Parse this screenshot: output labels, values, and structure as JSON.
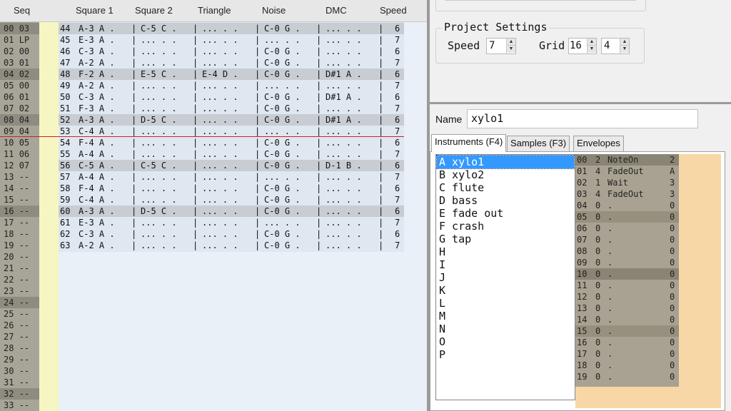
{
  "tracker": {
    "headers": [
      "Seq",
      "Square 1",
      "Square 2",
      "Triangle",
      "Noise",
      "DMC",
      "Speed"
    ],
    "seq": [
      [
        "00",
        "03"
      ],
      [
        "01",
        "LP"
      ],
      [
        "02",
        "00"
      ],
      [
        "03",
        "01"
      ],
      [
        "04",
        "02"
      ],
      [
        "05",
        "00"
      ],
      [
        "06",
        "01"
      ],
      [
        "07",
        "02"
      ],
      [
        "08",
        "04"
      ],
      [
        "09",
        "04"
      ],
      [
        "10",
        "05"
      ],
      [
        "11",
        "06"
      ],
      [
        "12",
        "07"
      ],
      [
        "13",
        "--"
      ],
      [
        "14",
        "--"
      ],
      [
        "15",
        "--"
      ],
      [
        "16",
        "--"
      ],
      [
        "17",
        "--"
      ],
      [
        "18",
        "--"
      ],
      [
        "19",
        "--"
      ],
      [
        "20",
        "--"
      ],
      [
        "21",
        "--"
      ],
      [
        "22",
        "--"
      ],
      [
        "23",
        "--"
      ],
      [
        "24",
        "--"
      ],
      [
        "25",
        "--"
      ],
      [
        "26",
        "--"
      ],
      [
        "27",
        "--"
      ],
      [
        "28",
        "--"
      ],
      [
        "29",
        "--"
      ],
      [
        "30",
        "--"
      ],
      [
        "31",
        "--"
      ],
      [
        "32",
        "--"
      ],
      [
        "33",
        "--"
      ]
    ],
    "seq_highlight": [
      0,
      4,
      8,
      16,
      24,
      32
    ],
    "pattern": [
      {
        "row": "44",
        "sq1": "A-3 A .",
        "sq2": "C-5 C .",
        "tri": "... . .",
        "noi": "C-0 G .",
        "dmc": "... . .",
        "spd": "6"
      },
      {
        "row": "45",
        "sq1": "E-3 A .",
        "sq2": "... . .",
        "tri": "... . .",
        "noi": "... . .",
        "dmc": "... . .",
        "spd": "7"
      },
      {
        "row": "46",
        "sq1": "C-3 A .",
        "sq2": "... . .",
        "tri": "... . .",
        "noi": "C-0 G .",
        "dmc": "... . .",
        "spd": "6"
      },
      {
        "row": "47",
        "sq1": "A-2 A .",
        "sq2": "... . .",
        "tri": "... . .",
        "noi": "C-0 G .",
        "dmc": "... . .",
        "spd": "7"
      },
      {
        "row": "48",
        "sq1": "F-2 A .",
        "sq2": "E-5 C .",
        "tri": "E-4 D .",
        "noi": "C-0 G .",
        "dmc": "D#1 A .",
        "spd": "6"
      },
      {
        "row": "49",
        "sq1": "A-2 A .",
        "sq2": "... . .",
        "tri": "... . .",
        "noi": "... . .",
        "dmc": "... . .",
        "spd": "7"
      },
      {
        "row": "50",
        "sq1": "C-3 A .",
        "sq2": "... . .",
        "tri": "... . .",
        "noi": "C-0 G .",
        "dmc": "D#1 A .",
        "spd": "6"
      },
      {
        "row": "51",
        "sq1": "F-3 A .",
        "sq2": "... . .",
        "tri": "... . .",
        "noi": "C-0 G .",
        "dmc": "... . .",
        "spd": "7"
      },
      {
        "row": "52",
        "sq1": "A-3 A .",
        "sq2": "D-5 C .",
        "tri": "... . .",
        "noi": "C-0 G .",
        "dmc": "D#1 A .",
        "spd": "6"
      },
      {
        "row": "53",
        "sq1": "C-4 A .",
        "sq2": "... . .",
        "tri": "... . .",
        "noi": "... . .",
        "dmc": "... . .",
        "spd": "7"
      },
      {
        "row": "54",
        "sq1": "F-4 A .",
        "sq2": "... . .",
        "tri": "... . .",
        "noi": "C-0 G .",
        "dmc": "... . .",
        "spd": "6"
      },
      {
        "row": "55",
        "sq1": "A-4 A .",
        "sq2": "... . .",
        "tri": "... . .",
        "noi": "C-0 G .",
        "dmc": "... . .",
        "spd": "7"
      },
      {
        "row": "56",
        "sq1": "C-5 A .",
        "sq2": "C-5 C .",
        "tri": "... . .",
        "noi": "C-0 G .",
        "dmc": "D-1 B .",
        "spd": "6"
      },
      {
        "row": "57",
        "sq1": "A-4 A .",
        "sq2": "... . .",
        "tri": "... . .",
        "noi": "... . .",
        "dmc": "... . .",
        "spd": "7"
      },
      {
        "row": "58",
        "sq1": "F-4 A .",
        "sq2": "... . .",
        "tri": "... . .",
        "noi": "C-0 G .",
        "dmc": "... . .",
        "spd": "6"
      },
      {
        "row": "59",
        "sq1": "C-4 A .",
        "sq2": "... . .",
        "tri": "... . .",
        "noi": "C-0 G .",
        "dmc": "... . .",
        "spd": "7"
      },
      {
        "row": "60",
        "sq1": "A-3 A .",
        "sq2": "D-5 C .",
        "tri": "... . .",
        "noi": "C-0 G .",
        "dmc": "... . .",
        "spd": "6"
      },
      {
        "row": "61",
        "sq1": "E-3 A .",
        "sq2": "... . .",
        "tri": "... . .",
        "noi": "... . .",
        "dmc": "... . .",
        "spd": "7"
      },
      {
        "row": "62",
        "sq1": "C-3 A .",
        "sq2": "... . .",
        "tri": "... . .",
        "noi": "C-0 G .",
        "dmc": "... . .",
        "spd": "6"
      },
      {
        "row": "63",
        "sq1": "A-2 A .",
        "sq2": "... . .",
        "tri": "... . .",
        "noi": "C-0 G .",
        "dmc": "... . .",
        "spd": "7"
      }
    ],
    "pattern_highlight": [
      0,
      4,
      8,
      12,
      16
    ],
    "separator": "|"
  },
  "project": {
    "legend": "Project Settings",
    "speed_label": "Speed",
    "speed_value": "7",
    "grid_label": "Grid",
    "grid_value_1": "16",
    "grid_value_2": "4",
    "spin_up": "▲",
    "spin_down": "▼"
  },
  "instrument_editor": {
    "name_label": "Name",
    "name_value": "xylo1",
    "tabs": [
      "Instruments (F4)",
      "Samples (F3)",
      "Envelopes"
    ],
    "instruments": [
      "A xylo1",
      "B xylo2",
      "C flute",
      "D bass",
      "E fade out",
      "F crash",
      "G tap",
      "H",
      "I",
      "J",
      "K",
      "L",
      "M",
      "N",
      "O",
      "P"
    ],
    "selected_index": 0,
    "envelope": [
      {
        "i": "00",
        "v": "2",
        "cmd": "NoteOn",
        "p": "2"
      },
      {
        "i": "01",
        "v": "4",
        "cmd": "FadeOut",
        "p": "A"
      },
      {
        "i": "02",
        "v": "1",
        "cmd": "Wait",
        "p": "3"
      },
      {
        "i": "03",
        "v": "4",
        "cmd": "FadeOut",
        "p": "3"
      },
      {
        "i": "04",
        "v": "0",
        "cmd": ".",
        "p": "0"
      },
      {
        "i": "05",
        "v": "0",
        "cmd": ".",
        "p": "0"
      },
      {
        "i": "06",
        "v": "0",
        "cmd": ".",
        "p": "0"
      },
      {
        "i": "07",
        "v": "0",
        "cmd": ".",
        "p": "0"
      },
      {
        "i": "08",
        "v": "0",
        "cmd": ".",
        "p": "0"
      },
      {
        "i": "09",
        "v": "0",
        "cmd": ".",
        "p": "0"
      },
      {
        "i": "10",
        "v": "0",
        "cmd": ".",
        "p": "0"
      },
      {
        "i": "11",
        "v": "0",
        "cmd": ".",
        "p": "0"
      },
      {
        "i": "12",
        "v": "0",
        "cmd": ".",
        "p": "0"
      },
      {
        "i": "13",
        "v": "0",
        "cmd": ".",
        "p": "0"
      },
      {
        "i": "14",
        "v": "0",
        "cmd": ".",
        "p": "0"
      },
      {
        "i": "15",
        "v": "0",
        "cmd": ".",
        "p": "0"
      },
      {
        "i": "16",
        "v": "0",
        "cmd": ".",
        "p": "0"
      },
      {
        "i": "17",
        "v": "0",
        "cmd": ".",
        "p": "0"
      },
      {
        "i": "18",
        "v": "0",
        "cmd": ".",
        "p": "0"
      },
      {
        "i": "19",
        "v": "0",
        "cmd": ".",
        "p": "0"
      }
    ],
    "envelope_highlight": [
      0,
      5,
      10,
      15
    ],
    "envelope_strong_highlight": [
      0,
      10
    ]
  },
  "colors": {
    "seq_bg": "#a7a598",
    "seq_highlight": "#8e8c80",
    "pattern_bg": "#dfe7f0",
    "pattern_highlight": "#c8cdd3",
    "cursor_line": "#d02020",
    "selection": "#3399ff",
    "envelope_bg": "#f7d7a5"
  }
}
